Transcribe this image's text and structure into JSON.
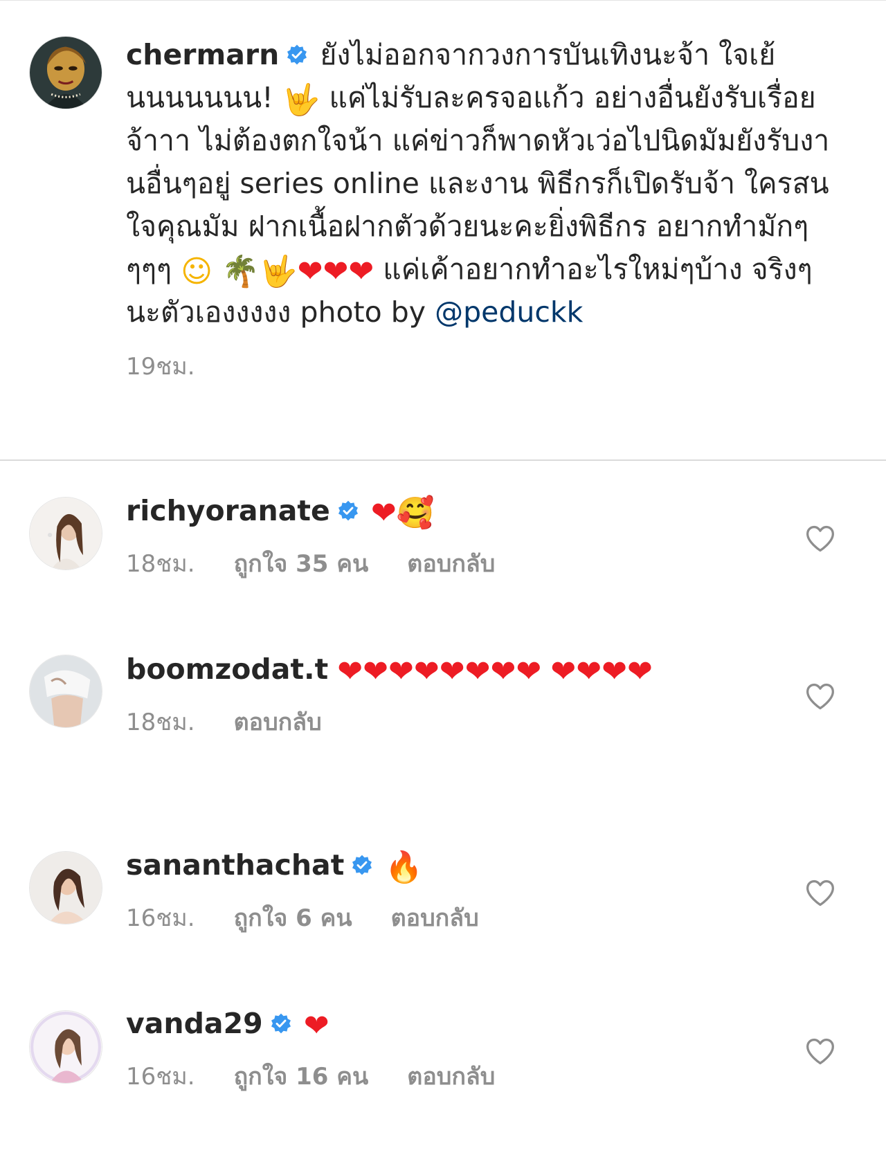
{
  "post": {
    "username": "chermarn",
    "caption_parts": [
      " ยังไม่ออกจากวงการบันเทิงนะจ้า  ใจเย้นนนนนนน! ",
      " แค่ไม่รับละครจอแก้ว อย่างอื่นยังรับเรื่อยจ้าาา ไม่ต้องตกใจน้า แค่ข่าวก็พาดหัวเว่อไปนิดมัมยังรับงานอื่นๆอยู่ series online และงาน พิธีกรก็เปิดรับจ้า ใครสนใจคุณมัม ฝากเนื้อฝากตัวด้วยนะคะยิ่งพิธีกร อยากทำมักๆๆๆๆ ",
      " แค่เค้าอยากทำอะไรใหม่ๆบ้าง จริงๆ นะตัวเองงงงง photo by "
    ],
    "mention": "@peduckk",
    "time": "19ชม."
  },
  "comments": [
    {
      "username": "richyoranate",
      "text": "",
      "time": "18ชม.",
      "likes": "ถูกใจ 35 คน",
      "reply": "ตอบกลับ"
    },
    {
      "username": "boomzodat.t",
      "text": "",
      "time": "18ชม.",
      "likes": "",
      "reply": "ตอบกลับ"
    },
    {
      "username": "sananthachat",
      "text": "",
      "time": "16ชม.",
      "likes": "ถูกใจ 6 คน",
      "reply": "ตอบกลับ"
    },
    {
      "username": "vanda29",
      "text": "",
      "time": "16ชม.",
      "likes": "ถูกใจ 16 คน",
      "reply": "ตอบกลับ"
    }
  ],
  "icons": {
    "verified": "verified-badge-icon",
    "like": "heart-outline-icon",
    "emoji_heart": "red-heart-emoji",
    "emoji_hand": "rock-hand-emoji",
    "emoji_palm": "palm-tree-emoji",
    "emoji_smile": "smiling-face-emoji",
    "emoji_hearts_face": "smiling-face-with-hearts-emoji",
    "emoji_fire": "fire-emoji"
  },
  "colors": {
    "verified_blue": "#3897f0",
    "mention_blue": "#00376b",
    "meta_gray": "#8e8e8e",
    "heart_red": "#ed1c24"
  }
}
